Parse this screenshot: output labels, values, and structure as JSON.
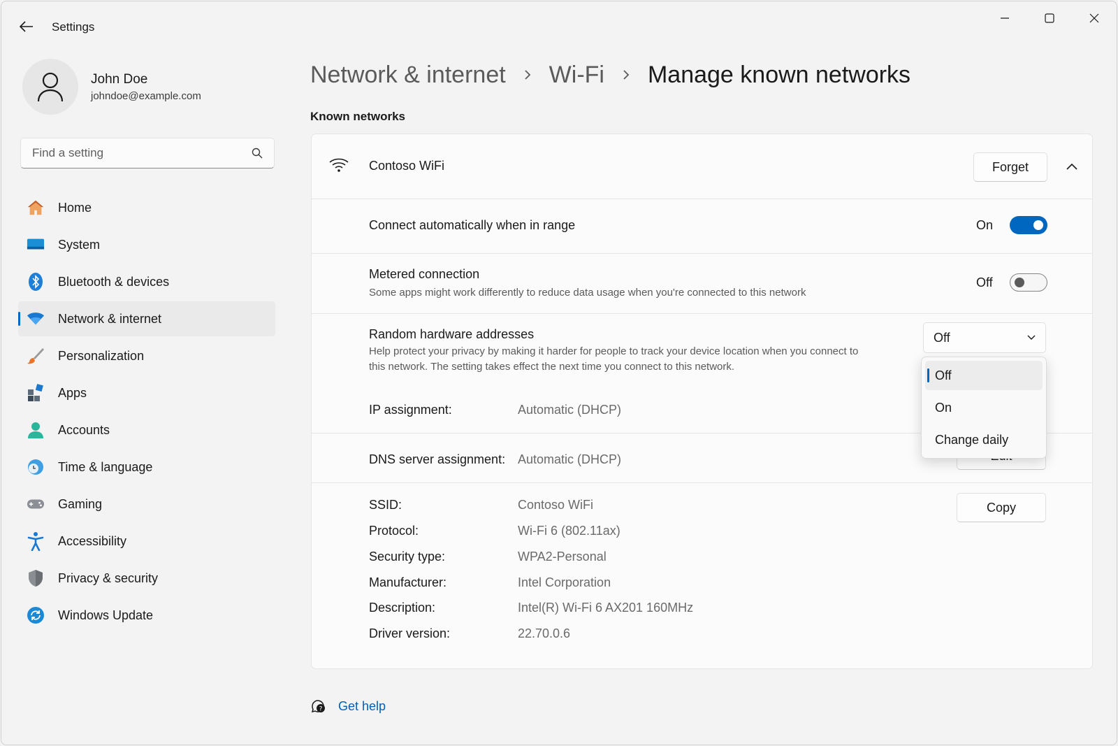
{
  "window": {
    "title": "Settings"
  },
  "profile": {
    "name": "John Doe",
    "email": "johndoe@example.com"
  },
  "search": {
    "placeholder": "Find a setting"
  },
  "sidebar": {
    "items": [
      {
        "label": "Home",
        "icon": "home-icon"
      },
      {
        "label": "System",
        "icon": "system-icon"
      },
      {
        "label": "Bluetooth & devices",
        "icon": "bluetooth-icon"
      },
      {
        "label": "Network & internet",
        "icon": "wifi-icon",
        "active": true
      },
      {
        "label": "Personalization",
        "icon": "brush-icon"
      },
      {
        "label": "Apps",
        "icon": "apps-icon"
      },
      {
        "label": "Accounts",
        "icon": "accounts-icon"
      },
      {
        "label": "Time & language",
        "icon": "globe-clock-icon"
      },
      {
        "label": "Gaming",
        "icon": "gamepad-icon"
      },
      {
        "label": "Accessibility",
        "icon": "accessibility-icon"
      },
      {
        "label": "Privacy & security",
        "icon": "shield-icon"
      },
      {
        "label": "Windows Update",
        "icon": "update-icon"
      }
    ]
  },
  "breadcrumb": [
    "Network & internet",
    "Wi-Fi",
    "Manage known networks"
  ],
  "known_networks": {
    "title": "Known networks",
    "network": {
      "name": "Contoso WiFi",
      "forget_label": "Forget",
      "connect_auto": {
        "label": "Connect automatically when in range",
        "state": "On",
        "enabled": true
      },
      "metered": {
        "label": "Metered connection",
        "description": "Some apps might work differently to reduce data usage when you're connected to this network",
        "state": "Off",
        "enabled": false
      },
      "random_hw": {
        "label": "Random hardware addresses",
        "description": "Help protect your privacy by making it harder for people to track your device location when you connect to this network. The setting takes effect the next time you connect to this network.",
        "selected": "Off",
        "options": [
          "Off",
          "On",
          "Change daily"
        ]
      },
      "ip_assignment": {
        "label": "IP assignment:",
        "value": "Automatic (DHCP)"
      },
      "dns_assignment": {
        "label": "DNS server assignment:",
        "value": "Automatic (DHCP)",
        "edit_label": "Edit"
      },
      "copy_label": "Copy",
      "properties": [
        {
          "label": "SSID:",
          "value": "Contoso WiFi"
        },
        {
          "label": "Protocol:",
          "value": "Wi-Fi 6 (802.11ax)"
        },
        {
          "label": "Security type:",
          "value": "WPA2-Personal"
        },
        {
          "label": "Manufacturer:",
          "value": "Intel Corporation"
        },
        {
          "label": "Description:",
          "value": "Intel(R) Wi-Fi 6 AX201 160MHz"
        },
        {
          "label": "Driver version:",
          "value": "22.70.0.6"
        }
      ]
    }
  },
  "help": {
    "label": "Get help"
  },
  "colors": {
    "accent": "#0067c0",
    "link": "#005fb8"
  }
}
